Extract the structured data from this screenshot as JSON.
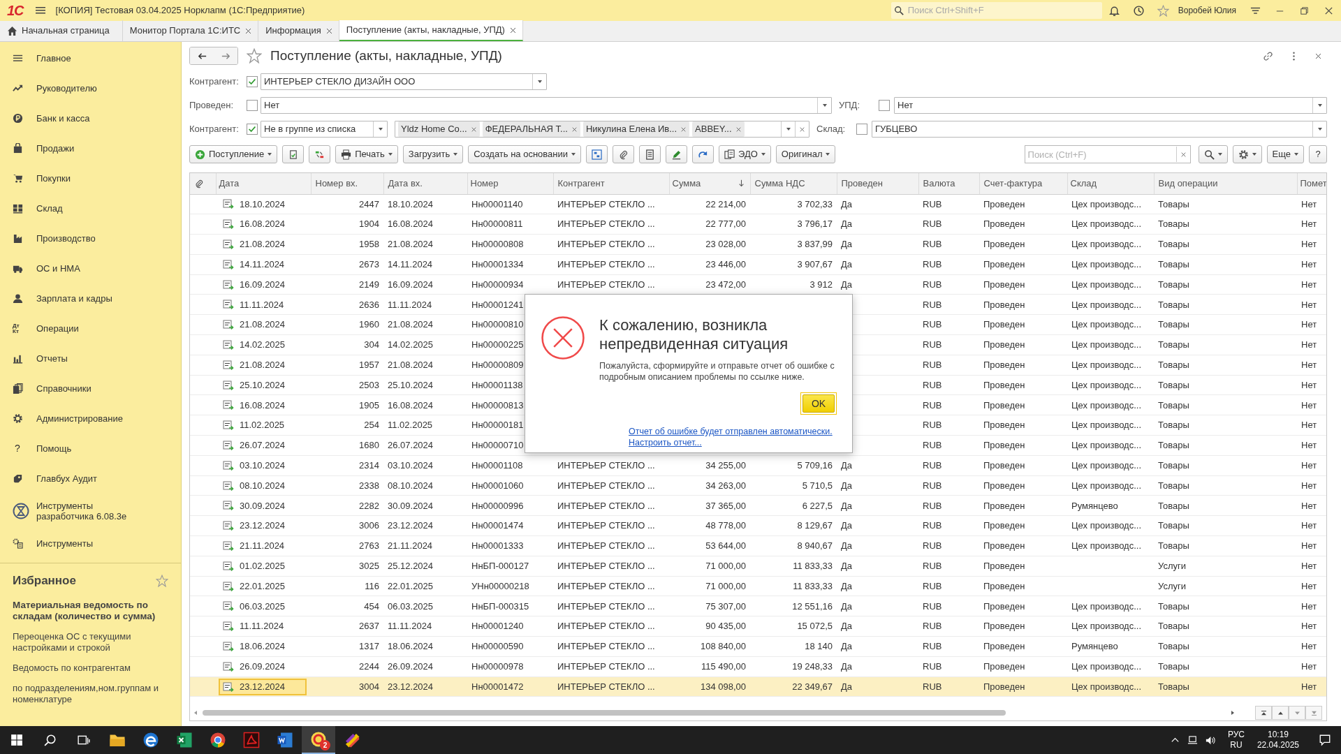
{
  "title_bar": {
    "logo": "1С",
    "title": "[КОПИЯ] Тестовая 03.04.2025 Норклапм (1С:Предприятие)",
    "search_placeholder": "Поиск Ctrl+Shift+F",
    "user": "Воробей Юлия"
  },
  "tabs": [
    {
      "kind": "home",
      "label": "Начальная страница",
      "selected": false
    },
    {
      "kind": "doc",
      "label": "Монитор Портала 1С:ИТС",
      "selected": false
    },
    {
      "kind": "doc",
      "label": "Информация",
      "selected": false
    },
    {
      "kind": "doc",
      "label": "Поступление (акты, накладные, УПД)",
      "selected": true
    }
  ],
  "sidebar": {
    "items": [
      {
        "label": "Главное"
      },
      {
        "label": "Руководителю"
      },
      {
        "label": "Банк и касса"
      },
      {
        "label": "Продажи"
      },
      {
        "label": "Покупки"
      },
      {
        "label": "Склад"
      },
      {
        "label": "Производство"
      },
      {
        "label": "ОС и НМА"
      },
      {
        "label": "Зарплата и кадры"
      },
      {
        "glyph": "Дт Кт",
        "label": "Операции"
      },
      {
        "label": "Отчеты"
      },
      {
        "label": "Справочники"
      },
      {
        "label": "Администрирование"
      },
      {
        "glyph": "?",
        "label": "Помощь"
      },
      {
        "label": "Главбух Аудит"
      },
      {
        "label": "Инструменты разработчика 6.08.3е"
      },
      {
        "label": "Инструменты"
      }
    ],
    "favorites": {
      "title": "Избранное",
      "items": [
        {
          "label": "Материальная ведомость по складам (количество и сумма)",
          "bold": true
        },
        {
          "label": "Переоценка ОС с текущими настройками и строкой",
          "bold": false
        },
        {
          "label": "Ведомость по контрагентам",
          "bold": false
        },
        {
          "label": "по подразделениям,ном.группам и номенклатуре",
          "bold": false
        }
      ]
    }
  },
  "form": {
    "title": "Поступление (акты, накладные, УПД)",
    "filters": {
      "counterparty": {
        "label": "Контрагент:",
        "checked": true,
        "value": "ИНТЕРЬЕР СТЕКЛО ДИЗАЙН ООО"
      },
      "posted": {
        "label": "Проведен:",
        "checked": false,
        "value": "Нет"
      },
      "upd": {
        "label": "УПД:",
        "checked": false,
        "value": "Нет"
      },
      "counterparty_group": {
        "label": "Контрагент:",
        "checked": true,
        "condition": "Не в группе из списка",
        "tags": [
          "Yldz Home Co...",
          "ФЕДЕРАЛЬНАЯ Т...",
          "Никулина Елена Ив...",
          "ABBEY..."
        ]
      },
      "warehouse": {
        "label": "Склад:",
        "checked": false,
        "value": "ГУБЦЕВО"
      }
    },
    "toolbar": [
      {
        "kind": "button",
        "label": "Поступление",
        "caret": true
      },
      {
        "kind": "icon",
        "caret": false
      },
      {
        "kind": "icon",
        "caret": false
      },
      {
        "kind": "button",
        "label": "Печать",
        "caret": true
      },
      {
        "kind": "button",
        "label": "Загрузить",
        "caret": true
      },
      {
        "kind": "button",
        "label": "Создать на основании",
        "caret": true
      },
      {
        "kind": "icon",
        "caret": false
      },
      {
        "kind": "icon",
        "caret": false
      },
      {
        "kind": "icon",
        "caret": false
      },
      {
        "kind": "icon",
        "caret": false
      },
      {
        "kind": "icon",
        "caret": false
      },
      {
        "kind": "button",
        "label": "ЭДО",
        "caret": true
      },
      {
        "kind": "button",
        "label": "Оригинал",
        "caret": true
      },
      {
        "kind": "search",
        "placeholder": "Поиск (Ctrl+F)"
      },
      {
        "kind": "icon",
        "caret": true
      },
      {
        "kind": "icon",
        "caret": true
      },
      {
        "kind": "button",
        "label": "Еще",
        "caret": true
      },
      {
        "kind": "glyph",
        "glyph": "?"
      }
    ]
  },
  "table": {
    "columns": [
      {
        "kind": "clip"
      },
      {
        "kind": "text",
        "label": "Дата"
      },
      {
        "kind": "text",
        "label": "Номер вх."
      },
      {
        "kind": "text",
        "label": "Дата вх."
      },
      {
        "kind": "text",
        "label": "Номер"
      },
      {
        "kind": "text",
        "label": "Контрагент"
      },
      {
        "kind": "text",
        "label": "Сумма",
        "sorted": true
      },
      {
        "kind": "text",
        "label": "Сумма НДС"
      },
      {
        "kind": "text",
        "label": "Проведен"
      },
      {
        "kind": "text",
        "label": "Валюта"
      },
      {
        "kind": "text",
        "label": "Счет-фактура"
      },
      {
        "kind": "text",
        "label": "Склад"
      },
      {
        "kind": "text",
        "label": "Вид операции"
      },
      {
        "kind": "text",
        "label": "Помет"
      }
    ],
    "rows": [
      {
        "selected": false,
        "cells": [
          "",
          "18.10.2024",
          "2447",
          "18.10.2024",
          "Нн00001140",
          "ИНТЕРЬЕР СТЕКЛО ...",
          "22 214,00",
          "3 702,33",
          "Да",
          "RUB",
          "Проведен",
          "Цех производс...",
          "Товары",
          "Нет"
        ]
      },
      {
        "selected": false,
        "cells": [
          "",
          "16.08.2024",
          "1904",
          "16.08.2024",
          "Нн00000811",
          "ИНТЕРЬЕР СТЕКЛО ...",
          "22 777,00",
          "3 796,17",
          "Да",
          "RUB",
          "Проведен",
          "Цех производс...",
          "Товары",
          "Нет"
        ]
      },
      {
        "selected": false,
        "cells": [
          "",
          "21.08.2024",
          "1958",
          "21.08.2024",
          "Нн00000808",
          "ИНТЕРЬЕР СТЕКЛО ...",
          "23 028,00",
          "3 837,99",
          "Да",
          "RUB",
          "Проведен",
          "Цех производс...",
          "Товары",
          "Нет"
        ]
      },
      {
        "selected": false,
        "cells": [
          "",
          "14.11.2024",
          "2673",
          "14.11.2024",
          "Нн00001334",
          "ИНТЕРЬЕР СТЕКЛО ...",
          "23 446,00",
          "3 907,67",
          "Да",
          "RUB",
          "Проведен",
          "Цех производс...",
          "Товары",
          "Нет"
        ]
      },
      {
        "selected": false,
        "cells": [
          "",
          "16.09.2024",
          "2149",
          "16.09.2024",
          "Нн00000934",
          "ИНТЕРЬЕР СТЕКЛО ...",
          "23 472,00",
          "3 912",
          "Да",
          "RUB",
          "Проведен",
          "Цех производс...",
          "Товары",
          "Нет"
        ]
      },
      {
        "selected": false,
        "cells": [
          "",
          "11.11.2024",
          "2636",
          "11.11.2024",
          "Нн00001241",
          null,
          null,
          null,
          null,
          "RUB",
          "Проведен",
          "Цех производс...",
          "Товары",
          "Нет"
        ]
      },
      {
        "selected": false,
        "cells": [
          "",
          "21.08.2024",
          "1960",
          "21.08.2024",
          "Нн00000810",
          null,
          null,
          null,
          null,
          "RUB",
          "Проведен",
          "Цех производс...",
          "Товары",
          "Нет"
        ]
      },
      {
        "selected": false,
        "cells": [
          "",
          "14.02.2025",
          "304",
          "14.02.2025",
          "Нн00000225",
          null,
          null,
          null,
          null,
          "RUB",
          "Проведен",
          "Цех производс...",
          "Товары",
          "Нет"
        ]
      },
      {
        "selected": false,
        "cells": [
          "",
          "21.08.2024",
          "1957",
          "21.08.2024",
          "Нн00000809",
          null,
          null,
          null,
          null,
          "RUB",
          "Проведен",
          "Цех производс...",
          "Товары",
          "Нет"
        ]
      },
      {
        "selected": false,
        "cells": [
          "",
          "25.10.2024",
          "2503",
          "25.10.2024",
          "Нн00001138",
          null,
          null,
          null,
          null,
          "RUB",
          "Проведен",
          "Цех производс...",
          "Товары",
          "Нет"
        ]
      },
      {
        "selected": false,
        "cells": [
          "",
          "16.08.2024",
          "1905",
          "16.08.2024",
          "Нн00000813",
          null,
          null,
          null,
          null,
          "RUB",
          "Проведен",
          "Цех производс...",
          "Товары",
          "Нет"
        ]
      },
      {
        "selected": false,
        "cells": [
          "",
          "11.02.2025",
          "254",
          "11.02.2025",
          "Нн00000181",
          null,
          null,
          null,
          null,
          "RUB",
          "Проведен",
          "Цех производс...",
          "Товары",
          "Нет"
        ]
      },
      {
        "selected": false,
        "cells": [
          "",
          "26.07.2024",
          "1680",
          "26.07.2024",
          "Нн00000710",
          null,
          null,
          null,
          null,
          "RUB",
          "Проведен",
          "Цех производс...",
          "Товары",
          "Нет"
        ]
      },
      {
        "selected": false,
        "cells": [
          "",
          "03.10.2024",
          "2314",
          "03.10.2024",
          "Нн00001108",
          "ИНТЕРЬЕР СТЕКЛО ...",
          "34 255,00",
          "5 709,16",
          "Да",
          "RUB",
          "Проведен",
          "Цех производс...",
          "Товары",
          "Нет"
        ]
      },
      {
        "selected": false,
        "cells": [
          "",
          "08.10.2024",
          "2338",
          "08.10.2024",
          "Нн00001060",
          "ИНТЕРЬЕР СТЕКЛО ...",
          "34 263,00",
          "5 710,5",
          "Да",
          "RUB",
          "Проведен",
          "Цех производс...",
          "Товары",
          "Нет"
        ]
      },
      {
        "selected": false,
        "cells": [
          "",
          "30.09.2024",
          "2282",
          "30.09.2024",
          "Нн00000996",
          "ИНТЕРЬЕР СТЕКЛО ...",
          "37 365,00",
          "6 227,5",
          "Да",
          "RUB",
          "Проведен",
          "Румянцево",
          "Товары",
          "Нет"
        ]
      },
      {
        "selected": false,
        "cells": [
          "",
          "23.12.2024",
          "3006",
          "23.12.2024",
          "Нн00001474",
          "ИНТЕРЬЕР СТЕКЛО ...",
          "48 778,00",
          "8 129,67",
          "Да",
          "RUB",
          "Проведен",
          "Цех производс...",
          "Товары",
          "Нет"
        ]
      },
      {
        "selected": false,
        "cells": [
          "",
          "21.11.2024",
          "2763",
          "21.11.2024",
          "Нн00001333",
          "ИНТЕРЬЕР СТЕКЛО ...",
          "53 644,00",
          "8 940,67",
          "Да",
          "RUB",
          "Проведен",
          "Цех производс...",
          "Товары",
          "Нет"
        ]
      },
      {
        "selected": false,
        "cells": [
          "",
          "01.02.2025",
          "3025",
          "25.12.2024",
          "НнБП-000127",
          "ИНТЕРЬЕР СТЕКЛО ...",
          "71 000,00",
          "11 833,33",
          "Да",
          "RUB",
          "Проведен",
          "",
          "Услуги",
          "Нет"
        ]
      },
      {
        "selected": false,
        "cells": [
          "",
          "22.01.2025",
          "116",
          "22.01.2025",
          "УНн00000218",
          "ИНТЕРЬЕР СТЕКЛО ...",
          "71 000,00",
          "11 833,33",
          "Да",
          "RUB",
          "Проведен",
          "",
          "Услуги",
          "Нет"
        ]
      },
      {
        "selected": false,
        "cells": [
          "",
          "06.03.2025",
          "454",
          "06.03.2025",
          "НнБП-000315",
          "ИНТЕРЬЕР СТЕКЛО ...",
          "75 307,00",
          "12 551,16",
          "Да",
          "RUB",
          "Проведен",
          "Цех производс...",
          "Товары",
          "Нет"
        ]
      },
      {
        "selected": false,
        "cells": [
          "",
          "11.11.2024",
          "2637",
          "11.11.2024",
          "Нн00001240",
          "ИНТЕРЬЕР СТЕКЛО ...",
          "90 435,00",
          "15 072,5",
          "Да",
          "RUB",
          "Проведен",
          "Цех производс...",
          "Товары",
          "Нет"
        ]
      },
      {
        "selected": false,
        "cells": [
          "",
          "18.06.2024",
          "1317",
          "18.06.2024",
          "Нн00000590",
          "ИНТЕРЬЕР СТЕКЛО ...",
          "108 840,00",
          "18 140",
          "Да",
          "RUB",
          "Проведен",
          "Румянцево",
          "Товары",
          "Нет"
        ]
      },
      {
        "selected": false,
        "cells": [
          "",
          "26.09.2024",
          "2244",
          "26.09.2024",
          "Нн00000978",
          "ИНТЕРЬЕР СТЕКЛО ...",
          "115 490,00",
          "19 248,33",
          "Да",
          "RUB",
          "Проведен",
          "Цех производс...",
          "Товары",
          "Нет"
        ]
      },
      {
        "selected": true,
        "cells": [
          "",
          "23.12.2024",
          "3004",
          "23.12.2024",
          "Нн00001472",
          "ИНТЕРЬЕР СТЕКЛО ...",
          "134 098,00",
          "22 349,67",
          "Да",
          "RUB",
          "Проведен",
          "Цех производс...",
          "Товары",
          "Нет"
        ]
      }
    ]
  },
  "dialog": {
    "title": "К сожалению, возникла непредвиденная ситуация",
    "message": "Пожалуйста, сформируйте и отправьте отчет об ошибке с подробным описанием проблемы по ссылке ниже.",
    "ok_button": "OK",
    "links": [
      "Отчет об ошибке будет отправлен автоматически.",
      "Настроить отчет..."
    ]
  },
  "taskbar": {
    "apps": [
      {
        "active": false
      },
      {
        "active": false
      },
      {
        "active": false
      },
      {
        "active": false
      },
      {
        "active": false
      },
      {
        "active": false
      },
      {
        "active": true,
        "badge": "2"
      },
      {
        "active": false
      }
    ],
    "language": "РУС",
    "layout": "RU",
    "time": "10:19",
    "date": "22.04.2025"
  }
}
